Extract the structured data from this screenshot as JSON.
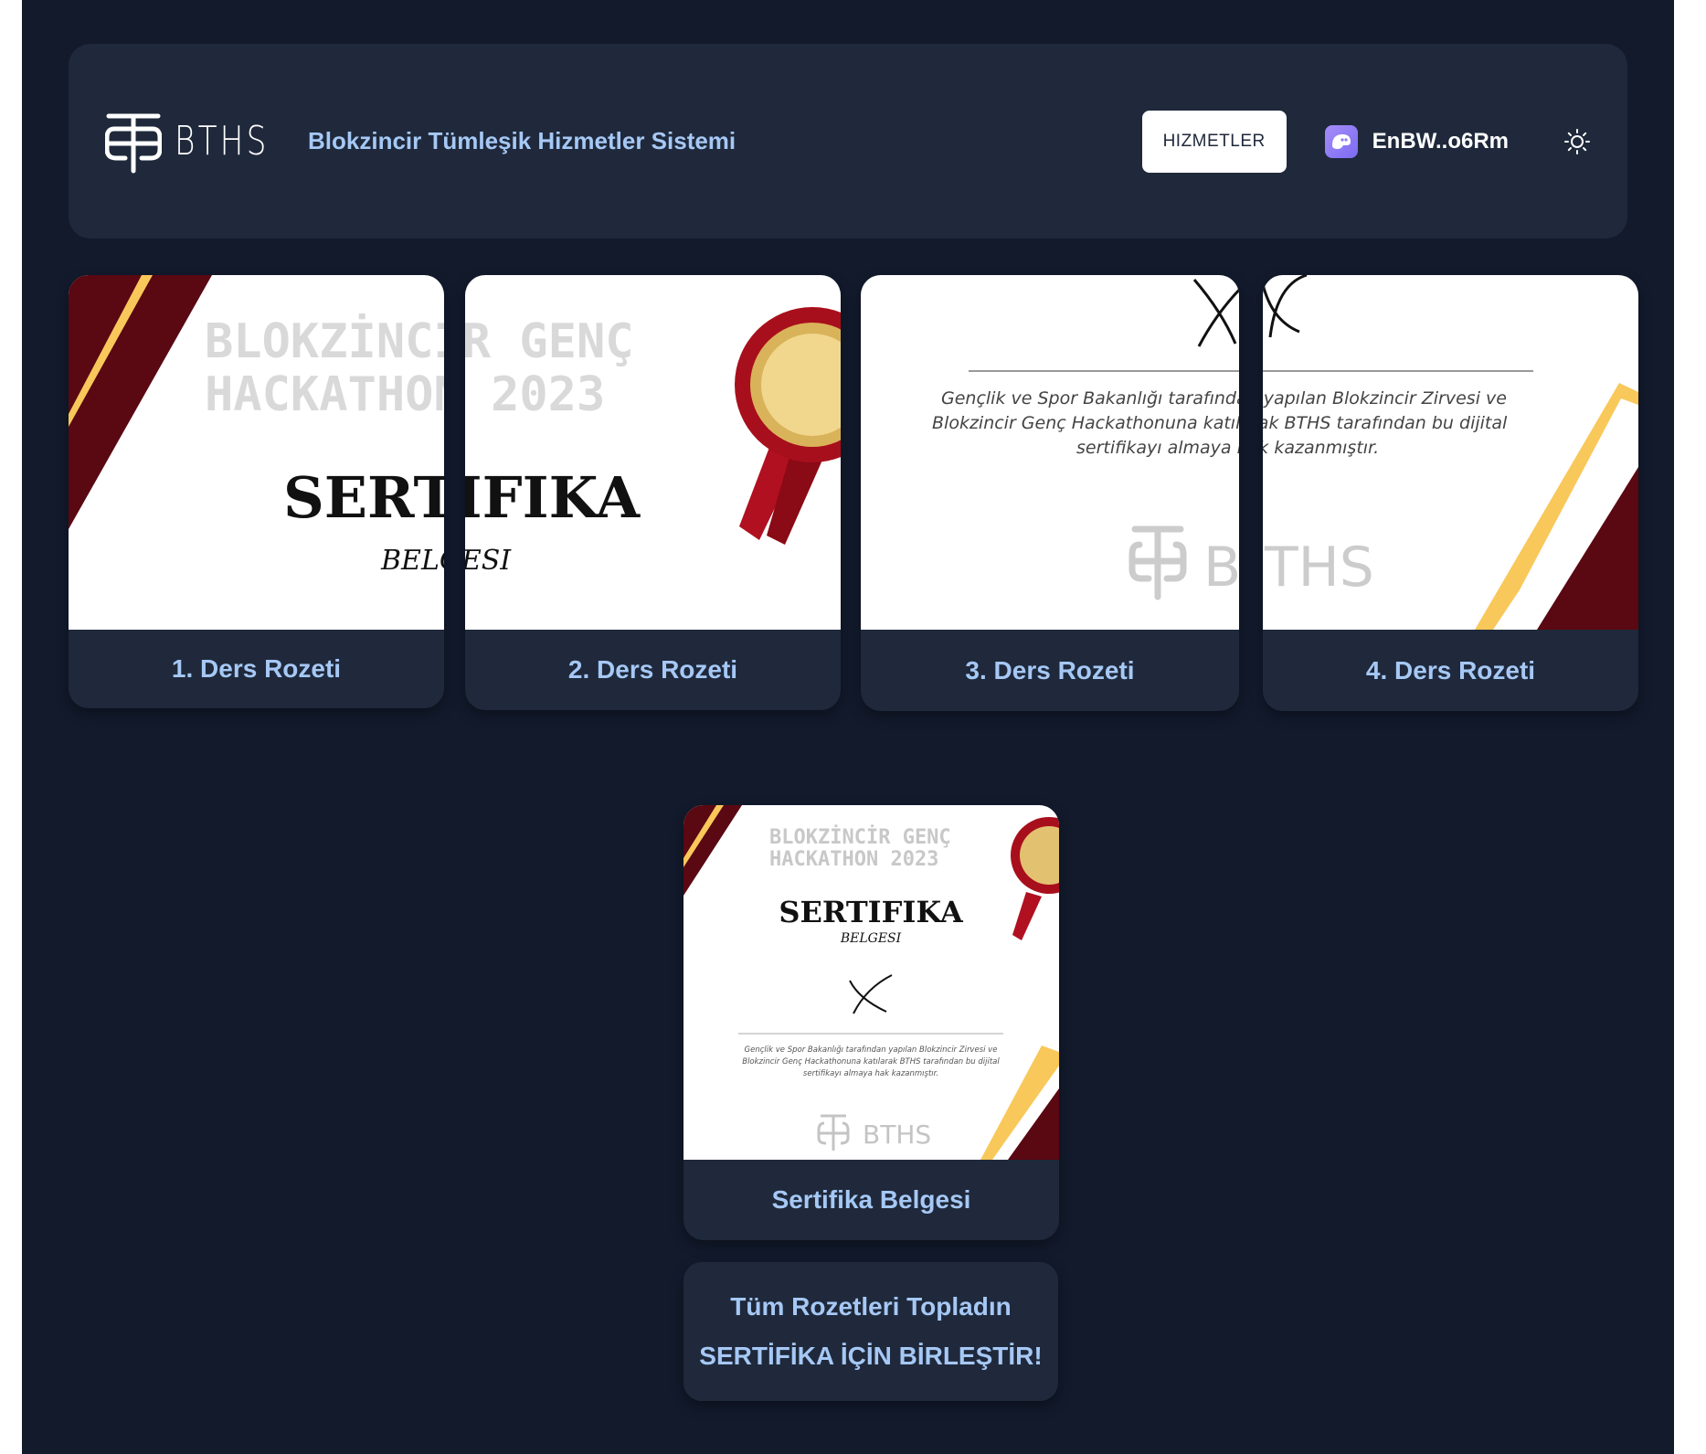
{
  "header": {
    "logo_text": "BTHS",
    "app_name": "Blokzincir Tümleşik Hizmetler Sistemi",
    "services_label": "HIZMETLER",
    "wallet_address": "EnBW..o6Rm"
  },
  "badges": [
    {
      "label": "1. Ders Rozeti"
    },
    {
      "label": "2. Ders Rozeti"
    },
    {
      "label": "3. Ders Rozeti"
    },
    {
      "label": "4. Ders Rozeti"
    }
  ],
  "certificate": {
    "label": "Sertifika Belgesi",
    "event_line1": "BLOKZİNCİR GENÇ",
    "event_line2": "HACKATHON 2023",
    "title": "SERTIFIKA",
    "subtitle": "BELGESI",
    "body_line1": "Gençlik ve Spor Bakanlığı tarafından yapılan Blokzincir Zirvesi ve",
    "body_line2": "Blokzincir Genç Hackathonuna katılarak BTHS tarafından bu dijital",
    "body_line3": "sertifikayı almaya hak kazanmıştır.",
    "footer_logo": "BTHS"
  },
  "combine": {
    "line1": "Tüm Rozetleri Topladın",
    "line2": "SERTİFİKA İÇİN BİRLEŞTİR!"
  },
  "colors": {
    "background": "#121a2c",
    "panel": "#1f293b",
    "accent_text": "#a6c8f5",
    "maroon": "#5a0812",
    "gold": "#f9c85a"
  }
}
